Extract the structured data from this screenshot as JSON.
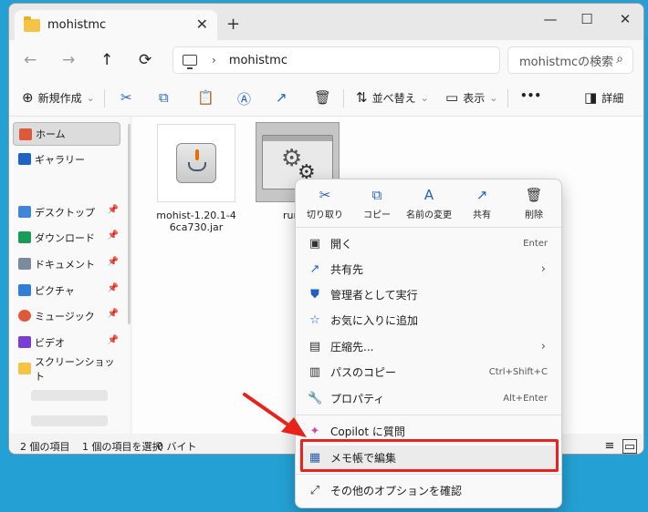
{
  "window": {
    "tab_title": "mohistmc",
    "tab_close": "✕",
    "new_tab": "+",
    "controls": {
      "minimize": "—",
      "maximize": "☐",
      "close": "✕"
    }
  },
  "nav": {
    "back": "←",
    "forward": "→",
    "up": "↑",
    "refresh": "⟳"
  },
  "address": {
    "separator": "›",
    "path": "mohistmc"
  },
  "search": {
    "placeholder": "mohistmcの検索",
    "icon": "⌕"
  },
  "toolbar": {
    "new_label": "新規作成",
    "sort_label": "並べ替え",
    "view_label": "表示",
    "more": "•••",
    "details_label": "詳細"
  },
  "sidebar": {
    "items": [
      {
        "label": "ホーム",
        "color": "#e0583a"
      },
      {
        "label": "ギャラリー",
        "color": "#1f62c6"
      },
      {
        "label": "デスクトップ",
        "color": "#3f86d9"
      },
      {
        "label": "ダウンロード",
        "color": "#1a9b5a"
      },
      {
        "label": "ドキュメント",
        "color": "#7a8aa0"
      },
      {
        "label": "ピクチャ",
        "color": "#2f7fd6"
      },
      {
        "label": "ミュージック",
        "color": "#e0583a"
      },
      {
        "label": "ビデオ",
        "color": "#7a3fd1"
      },
      {
        "label": "スクリーンショット",
        "color": "#f6c445"
      }
    ],
    "pin": "📌"
  },
  "files": [
    {
      "name": "mohist-1.20.1-46ca730.jar"
    },
    {
      "name": "run.bat"
    }
  ],
  "status": {
    "count": "2 個の項目",
    "selected": "1 個の項目を選択",
    "size": "0 バイト"
  },
  "context_menu": {
    "quick_actions": [
      {
        "label": "切り取り",
        "icon": "✂"
      },
      {
        "label": "コピー",
        "icon": "⧉"
      },
      {
        "label": "名前の変更",
        "icon": "A"
      },
      {
        "label": "共有",
        "icon": "↗"
      },
      {
        "label": "削除",
        "icon": "🗑"
      }
    ],
    "items": [
      {
        "label": "開く",
        "shortcut": "Enter",
        "icon": "▣"
      },
      {
        "label": "共有先",
        "shortcut": "",
        "icon": "↗",
        "arrow": "›"
      },
      {
        "label": "管理者として実行",
        "shortcut": "",
        "icon": "⛊"
      },
      {
        "label": "お気に入りに追加",
        "shortcut": "",
        "icon": "☆"
      },
      {
        "label": "圧縮先...",
        "shortcut": "",
        "icon": "▤",
        "arrow": "›"
      },
      {
        "label": "パスのコピー",
        "shortcut": "Ctrl+Shift+C",
        "icon": "▥"
      },
      {
        "label": "プロパティ",
        "shortcut": "Alt+Enter",
        "icon": "🔧"
      },
      {
        "label": "Copilot に質問",
        "shortcut": "",
        "icon": "✦"
      },
      {
        "label": "メモ帳で編集",
        "shortcut": "",
        "icon": "▦"
      },
      {
        "label": "その他のオプションを確認",
        "shortcut": "",
        "icon": "⤢"
      }
    ]
  },
  "colors": {
    "accent": "#1f62c6",
    "highlight_box": "#e8231b",
    "desktop": "#24a0d4"
  }
}
